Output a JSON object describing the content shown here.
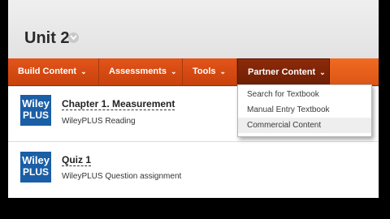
{
  "unit": {
    "title": "Unit 2"
  },
  "nav": [
    {
      "label": "Build Content",
      "chevron": "⌄"
    },
    {
      "label": "Assessments",
      "chevron": "⌄"
    },
    {
      "label": "Tools",
      "chevron": "⌄"
    },
    {
      "label": "Partner Content",
      "chevron": "⌄"
    }
  ],
  "dropdown": {
    "items": [
      "Search for Textbook",
      "Manual Entry Textbook",
      "Commercial Content"
    ]
  },
  "content": [
    {
      "logo_line1": "Wiley",
      "logo_line2": "PLUS",
      "title": "Chapter 1. Measurement",
      "subtitle": "WileyPLUS Reading"
    },
    {
      "logo_line1": "Wiley",
      "logo_line2": "PLUS",
      "title": "Quiz 1",
      "subtitle": "WileyPLUS Question assignment"
    }
  ],
  "colors": {
    "nav": "#d24a12",
    "nav_active": "#7a2206",
    "logo": "#1a5ea6"
  }
}
